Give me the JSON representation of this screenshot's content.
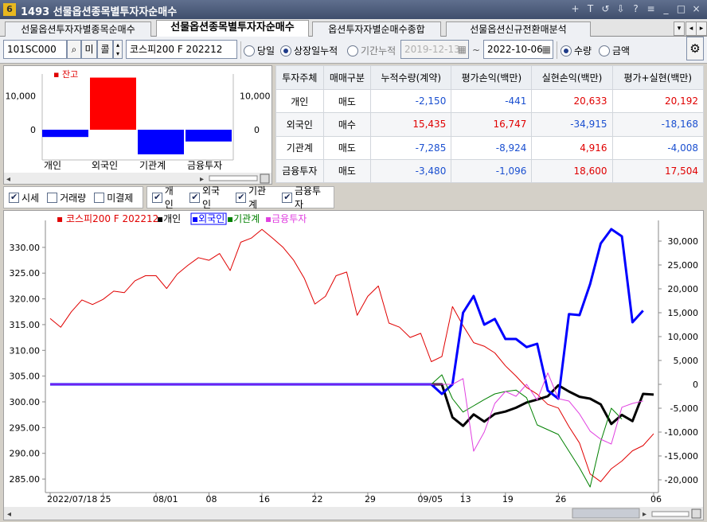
{
  "window": {
    "app_icon": "6",
    "title": "1493  선물옵션종목별투자자순매수",
    "controls": [
      "+",
      "T",
      "↺",
      "⇩",
      "?",
      "≡",
      "_",
      "□",
      "×"
    ]
  },
  "tabs": [
    {
      "label": "선물옵션투자자별종목순매수",
      "active": false
    },
    {
      "label": "선물옵션종목별투자자순매수",
      "active": true
    },
    {
      "label": "옵션투자자별순매수종합",
      "active": false
    },
    {
      "label": "선물옵션신규전환매분석",
      "active": false
    }
  ],
  "toolbar": {
    "code": "101SC000",
    "btn_mi": "미",
    "btn_call": "콜",
    "product_name": "코스피200 F 202212",
    "period_options": [
      {
        "label": "당일",
        "selected": false
      },
      {
        "label": "상장일누적",
        "selected": true
      },
      {
        "label": "기간누적",
        "selected": false
      }
    ],
    "date_from": "2019-12-13",
    "date_sep": "~",
    "date_to": "2022-10-06",
    "unit_options": [
      {
        "label": "수량",
        "selected": true
      },
      {
        "label": "금액",
        "selected": false
      }
    ]
  },
  "mini_chart": {
    "legend": "▪ 잔고",
    "y_ticks_left": [
      "10,000",
      "0"
    ],
    "y_ticks_right": [
      "10,000",
      "0"
    ],
    "categories": [
      "개인",
      "외국인",
      "기관계",
      "금융투자"
    ],
    "values": [
      -2150,
      15435,
      -7285,
      -3480
    ],
    "colors": [
      "#0000ff",
      "#ff0000",
      "#0000ff",
      "#0000ff"
    ]
  },
  "table": {
    "headers": [
      "투자주체",
      "매매구분",
      "누적수량(계약)",
      "평가손익(백만)",
      "실현손익(백만)",
      "평가+실현(백만)"
    ],
    "rows": [
      [
        "개인",
        "매도",
        "-2,150",
        "-441",
        "20,633",
        "20,192"
      ],
      [
        "외국인",
        "매수",
        "15,435",
        "16,747",
        "-34,915",
        "-18,168"
      ],
      [
        "기관계",
        "매도",
        "-7,285",
        "-8,924",
        "4,916",
        "-4,008"
      ],
      [
        "금융투자",
        "매도",
        "-3,480",
        "-1,096",
        "18,600",
        "17,504"
      ]
    ]
  },
  "checkbox_groups": [
    [
      {
        "label": "시세",
        "checked": true
      },
      {
        "label": "거래량",
        "checked": false
      },
      {
        "label": "미결제",
        "checked": false
      }
    ],
    [
      {
        "label": "개인",
        "checked": true
      },
      {
        "label": "외국인",
        "checked": true
      },
      {
        "label": "기관계",
        "checked": true
      },
      {
        "label": "금융투자",
        "checked": true
      }
    ]
  ],
  "chart_data": {
    "type": "line",
    "legend": [
      {
        "name": "▪ 코스피200 F 202212",
        "color": "#e00000"
      },
      {
        "name": "▪개인",
        "color": "#000000"
      },
      {
        "name": "▪외국인",
        "color": "#0000ff"
      },
      {
        "name": "▪기관계",
        "color": "#008000"
      },
      {
        "name": "▪금융투자",
        "color": "#e040e0"
      }
    ],
    "x_tick_labels": [
      "2022/07/18",
      "25",
      "08/01",
      "08",
      "16",
      "22",
      "29",
      "09/05",
      "13",
      "19",
      "26",
      "06"
    ],
    "left_axis": {
      "ticks": [
        "330.00",
        "325.00",
        "320.00",
        "315.00",
        "310.00",
        "305.00",
        "300.00",
        "295.00",
        "290.00",
        "285.00"
      ],
      "range": [
        283,
        334
      ]
    },
    "right_axis": {
      "ticks": [
        "30,000",
        "25,000",
        "20,000",
        "15,000",
        "10,000",
        "5,000",
        "0",
        "-5,000",
        "-10,000",
        "-15,000",
        "-20,000"
      ],
      "range": [
        -22000,
        33000
      ]
    },
    "days": 58,
    "series": [
      {
        "name": "코스피200 F 202212",
        "axis": "left",
        "color": "#e00000",
        "width": 1,
        "values": [
          316.2,
          314.5,
          317.5,
          319.8,
          318.9,
          319.9,
          321.5,
          321.2,
          323.5,
          324.5,
          324.5,
          322.0,
          324.8,
          326.5,
          328.0,
          327.5,
          328.8,
          325.5,
          331.0,
          331.8,
          333.5,
          331.8,
          330.0,
          327.5,
          324.0,
          319.0,
          320.5,
          324.5,
          325.2,
          316.8,
          320.5,
          322.5,
          315.3,
          314.5,
          312.5,
          313.3,
          307.8,
          308.8,
          318.5,
          314.8,
          311.5,
          310.8,
          309.5,
          307.0,
          305.0,
          302.8,
          301.5,
          299.5,
          298.8,
          295.2,
          292.0,
          286.0,
          284.5,
          287.0,
          288.5,
          290.5,
          291.5,
          293.8
        ]
      },
      {
        "name": "개인",
        "axis": "right",
        "color": "#000000",
        "width": 3,
        "values": [
          0,
          0,
          0,
          0,
          0,
          0,
          0,
          0,
          0,
          0,
          0,
          0,
          0,
          0,
          0,
          0,
          0,
          0,
          0,
          0,
          0,
          0,
          0,
          0,
          0,
          0,
          0,
          0,
          0,
          0,
          0,
          0,
          0,
          0,
          0,
          0,
          0,
          0,
          -6900,
          -8700,
          -6300,
          -7800,
          -6200,
          -5700,
          -4900,
          -3800,
          -3200,
          -2500,
          -200,
          -1500,
          -2600,
          -3000,
          -4200,
          -8300,
          -6400,
          -7700,
          -2000,
          -2150
        ]
      },
      {
        "name": "외국인",
        "axis": "right",
        "color": "#0000ff",
        "width": 3,
        "values": [
          0,
          0,
          0,
          0,
          0,
          0,
          0,
          0,
          0,
          0,
          0,
          0,
          0,
          0,
          0,
          0,
          0,
          0,
          0,
          0,
          0,
          0,
          0,
          0,
          0,
          0,
          0,
          0,
          0,
          0,
          0,
          0,
          0,
          0,
          0,
          0,
          0,
          -2000,
          0,
          15000,
          18500,
          12500,
          13700,
          9500,
          9500,
          7800,
          8500,
          -1300,
          -3000,
          14700,
          14500,
          21000,
          29500,
          32500,
          31000,
          13000,
          15435
        ]
      },
      {
        "name": "기관계",
        "axis": "right",
        "color": "#008000",
        "width": 1,
        "values": [
          0,
          0,
          0,
          0,
          0,
          0,
          0,
          0,
          0,
          0,
          0,
          0,
          0,
          0,
          0,
          0,
          0,
          0,
          0,
          0,
          0,
          0,
          0,
          0,
          0,
          0,
          0,
          0,
          0,
          0,
          0,
          0,
          0,
          0,
          0,
          0,
          0,
          2000,
          -3000,
          -5800,
          -4500,
          -3200,
          -2000,
          -1500,
          -1200,
          -2800,
          -8500,
          -9500,
          -10500,
          -14000,
          -17500,
          -21500,
          -12000,
          -5000,
          -7285
        ]
      },
      {
        "name": "금융투자",
        "axis": "right",
        "color": "#e040e0",
        "width": 1,
        "values": [
          0,
          0,
          0,
          0,
          0,
          0,
          0,
          0,
          0,
          0,
          0,
          0,
          0,
          0,
          0,
          0,
          0,
          0,
          0,
          0,
          0,
          0,
          0,
          0,
          0,
          0,
          0,
          0,
          0,
          0,
          0,
          0,
          0,
          0,
          0,
          0,
          0,
          0,
          0,
          1200,
          -14000,
          -10000,
          -4000,
          -1500,
          -2500,
          0,
          -3300,
          2400,
          -3000,
          -3500,
          -6200,
          -9800,
          -11500,
          -12500,
          -4800,
          -4000,
          -3480
        ]
      }
    ]
  }
}
